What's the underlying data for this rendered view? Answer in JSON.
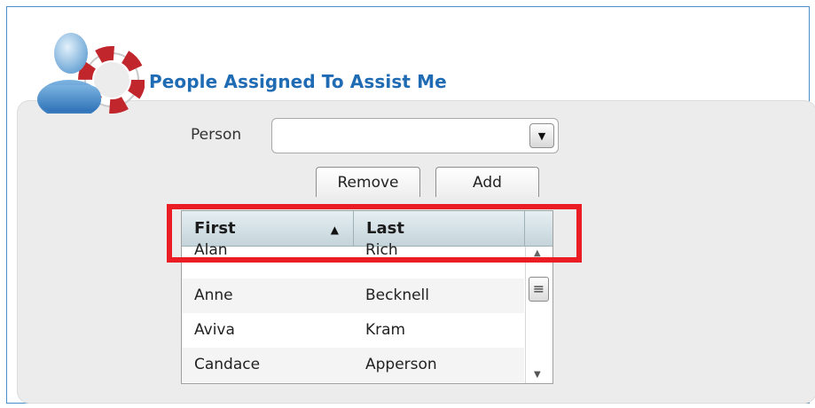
{
  "section": {
    "title": "People Assigned To Assist Me"
  },
  "form": {
    "person_label": "Person",
    "person_value": "",
    "dropdown_glyph": "▼"
  },
  "buttons": {
    "remove_label": "Remove",
    "add_label": "Add"
  },
  "grid": {
    "columns": [
      {
        "label": "First",
        "sort_indicator": "▲"
      },
      {
        "label": "Last",
        "sort_indicator": ""
      }
    ],
    "rows": [
      {
        "first": "Alan",
        "last": "Rich"
      },
      {
        "first": "Anne",
        "last": "Becknell"
      },
      {
        "first": "Aviva",
        "last": "Kram"
      },
      {
        "first": "Candace",
        "last": "Apperson"
      }
    ]
  },
  "scrollbar": {
    "up_glyph": "▲",
    "thumb_glyph": "≡",
    "down_glyph": "▼"
  },
  "icons": {
    "app_icon": "person-lifebuoy-icon",
    "dropdown_icon": "chevron-down-icon",
    "sort_icon": "sort-ascending-icon"
  },
  "colors": {
    "title": "#1f6bb4",
    "highlight": "#ea1c24",
    "frame": "#4a8fc8"
  }
}
